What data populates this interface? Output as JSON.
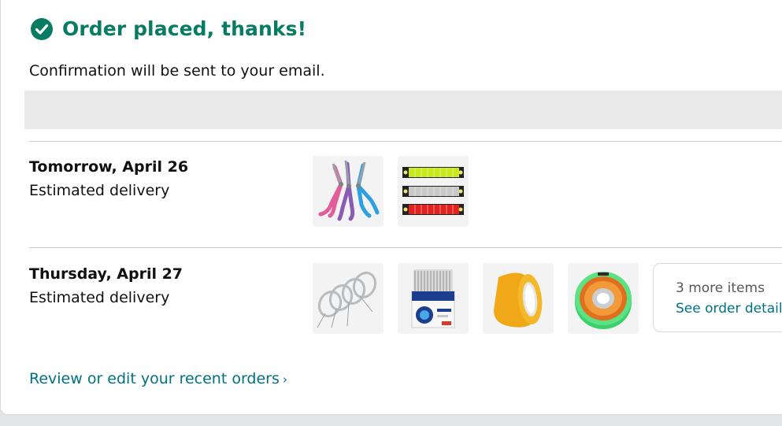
{
  "header": {
    "title": "Order placed, thanks!",
    "confirmation": "Confirmation will be sent to your email.",
    "accent_color": "#067d62",
    "icon": "check-circle-icon"
  },
  "deliveries": [
    {
      "date": "Tomorrow, April 26",
      "label": "Estimated delivery",
      "items": [
        "jewelry-pliers",
        "wire-markers"
      ]
    },
    {
      "date": "Thursday, April 27",
      "label": "Estimated delivery",
      "items": [
        "silver-wire-coils",
        "spoke-reflectors",
        "orange-tape-roll",
        "solder-wire-spool"
      ],
      "more": {
        "count_label": "3 more items",
        "link_label": "See order details"
      }
    }
  ],
  "footer": {
    "review_link": "Review or edit your recent orders",
    "chevron": "›",
    "link_color": "#007185"
  }
}
